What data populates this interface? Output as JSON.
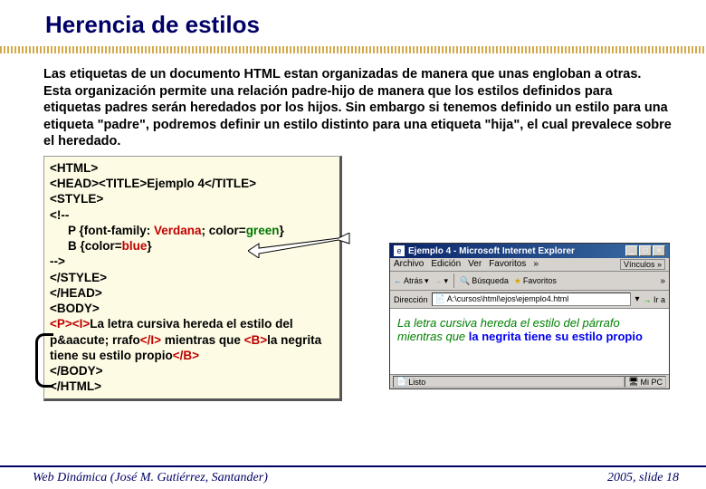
{
  "slide": {
    "title": "Herencia de estilos",
    "paragraph": "Las etiquetas de un documento HTML estan organizadas de manera que unas engloban a otras. Esta organización permite una relación padre-hijo de manera que los estilos definidos para etiquetas padres serán heredados por los hijos. Sin embargo si tenemos definido un estilo para una etiqueta \"padre\", podremos definir un estilo distinto para una etiqueta \"hija\", el cual prevalece sobre el heredado."
  },
  "code": {
    "l1": "<HTML>",
    "l2": "<HEAD><TITLE>Ejemplo 4</TITLE>",
    "l3": "<STYLE>",
    "l4": "<!--",
    "l5a": "P {font-family:",
    "l5b": " Verdana",
    "l5c": "; color=",
    "l5d": "green",
    "l5e": "}",
    "l6a": "B {color=",
    "l6b": "blue",
    "l6c": "}",
    "l7": "-->",
    "l8": "</STYLE>",
    "l9": "</HEAD>",
    "l10": "<BODY>",
    "l11a": "<P><I>",
    "l11b": "La letra cursiva hereda el estilo del p&aacute; rrafo",
    "l11c": "</I>",
    "l11d": " mientras que ",
    "l11e": "<B>",
    "l11f": "la negrita tiene su estilo propio",
    "l11g": "</B>",
    "l12": "</BODY>",
    "l13": "</HTML>"
  },
  "browser": {
    "title": "Ejemplo 4 - Microsoft Internet Explorer",
    "menu": {
      "archivo": "Archivo",
      "edicion": "Edición",
      "ver": "Ver",
      "favoritos": "Favoritos",
      "links": "Vínculos"
    },
    "toolbar": {
      "atras": "Atrás",
      "busqueda": "Búsqueda",
      "favoritos": "Favoritos"
    },
    "address_label": "Dirección",
    "address_value": "A:\\cursos\\html\\ejos\\ejemplo4.html",
    "go": "Ir a",
    "viewport": {
      "italic": "La letra cursiva hereda el estilo del párrafo",
      "mid": " mientras que ",
      "bold": "la negrita tiene su estilo propio"
    },
    "status_left": "Listo",
    "status_right": "Mi PC"
  },
  "footer": {
    "left": "Web Dinámica (José M. Gutiérrez, Santander)",
    "right": "2005, slide 18"
  },
  "icons": {
    "ie": "e",
    "min": "_",
    "max": "□",
    "close": "×",
    "dropdown": "▾",
    "back_arrow": "←",
    "fwd_arrow": "→",
    "search": "🔍",
    "star": "★",
    "page": "📄",
    "computer": "🖥",
    "check": "✓",
    "chevrons": "»"
  }
}
